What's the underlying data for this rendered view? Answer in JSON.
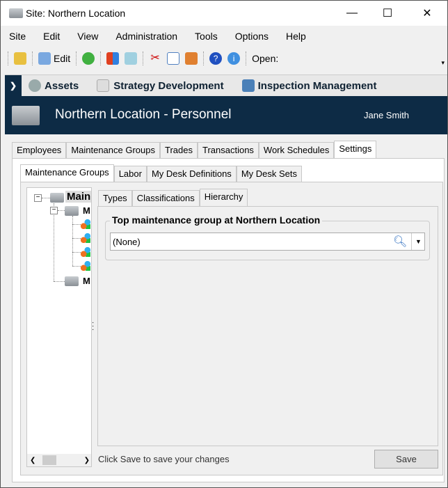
{
  "window": {
    "title": "Site: Northern Location",
    "minimize": "—",
    "maximize": "☐",
    "close": "✕"
  },
  "menu": [
    "Site",
    "Edit",
    "View",
    "Administration",
    "Tools",
    "Options",
    "Help"
  ],
  "toolbar": {
    "edit_label": "Edit",
    "open_label": "Open:"
  },
  "modules": [
    "Assets",
    "Strategy Development",
    "Inspection Management"
  ],
  "header": {
    "title": "Northern Location - Personnel",
    "user": "Jane Smith"
  },
  "main_tabs": [
    "Employees",
    "Maintenance Groups",
    "Trades",
    "Transactions",
    "Work Schedules",
    "Settings"
  ],
  "sub_tabs": [
    "Maintenance Groups",
    "Labor",
    "My Desk Definitions",
    "My Desk Sets"
  ],
  "tree": {
    "root": "Main",
    "child1": "M",
    "child2": "M"
  },
  "inner_tabs": [
    "Types",
    "Classifications",
    "Hierarchy"
  ],
  "group": {
    "label": "Top maintenance group at Northern Location",
    "value": "(None)"
  },
  "status": "Click Save to save your changes",
  "save_label": "Save"
}
